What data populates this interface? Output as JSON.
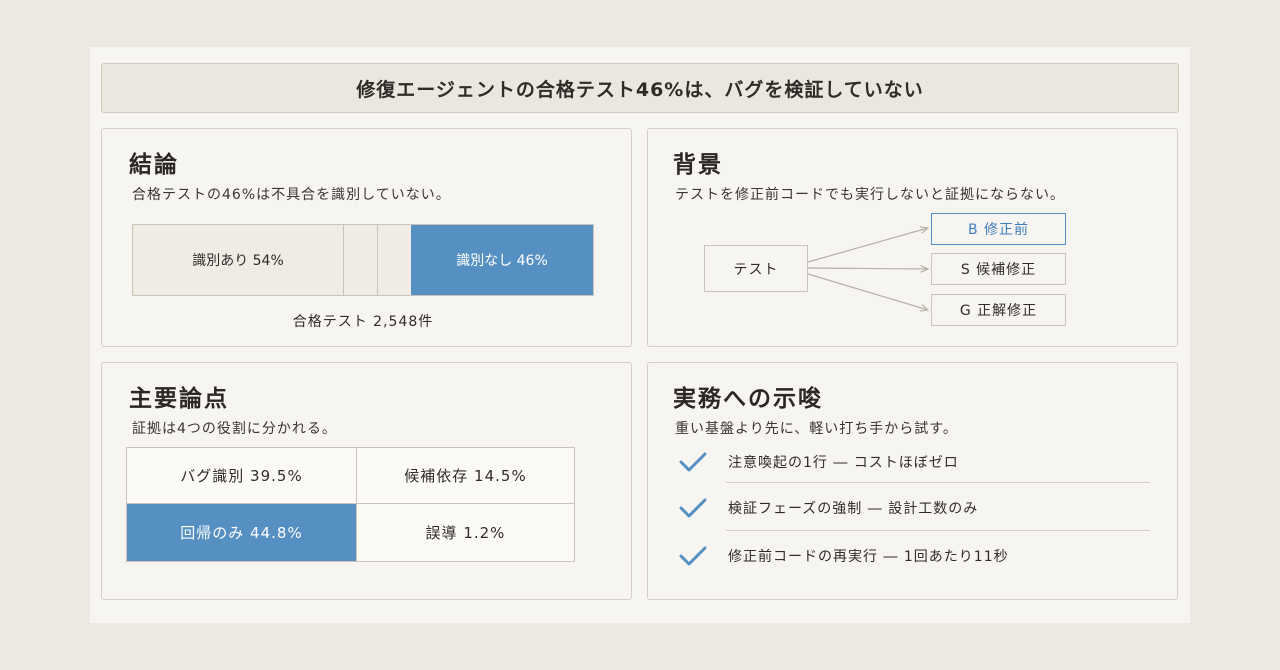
{
  "banner": {
    "title": "修復エージェントの合格テスト46%は、バグを検証していない"
  },
  "conclusion": {
    "heading": "結論",
    "subtitle": "合格テストの46%は不具合を識別していない。",
    "identified_label": "識別あり 54%",
    "identified_pct": 54,
    "not_identified_label": "識別なし 46%",
    "not_identified_pct": 46,
    "caption": "合格テスト 2,548件"
  },
  "background": {
    "heading": "背景",
    "subtitle": "テストを修正前コードでも実行しないと証拠にならない。",
    "source_node": "テスト",
    "targets": [
      {
        "label": "B 修正前",
        "highlight": true
      },
      {
        "label": "S 候補修正",
        "highlight": false
      },
      {
        "label": "G 正解修正",
        "highlight": false
      }
    ],
    "colors": {
      "accent": "#5690c2",
      "arrow": "#b9b0a4"
    }
  },
  "points": {
    "heading": "主要論点",
    "subtitle": "証拠は4つの役割に分かれる。",
    "cells": [
      {
        "label": "バグ識別 39.5%",
        "highlight": false
      },
      {
        "label": "候補依存 14.5%",
        "highlight": false
      },
      {
        "label": "回帰のみ 44.8%",
        "highlight": true
      },
      {
        "label": "誤導 1.2%",
        "highlight": false
      }
    ]
  },
  "implications": {
    "heading": "実務への示唆",
    "subtitle": "重い基盤より先に、軽い打ち手から試す。",
    "items": [
      {
        "icon": "checkmark-icon",
        "label": "注意喚起の1行 ― コストほぼゼロ"
      },
      {
        "icon": "checkmark-icon",
        "label": "検証フェーズの強制 ― 設計工数のみ"
      },
      {
        "icon": "checkmark-icon",
        "label": "修正前コードの再実行 ― 1回あたり11秒"
      }
    ]
  }
}
